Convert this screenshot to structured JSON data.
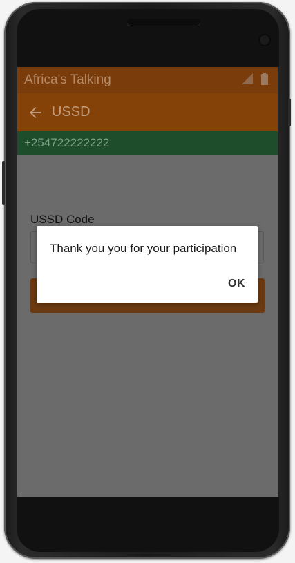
{
  "status_bar": {
    "title": "Africa's Talking",
    "icons": [
      "signal-icon",
      "battery-icon"
    ]
  },
  "app_bar": {
    "back_icon": "arrow-left-icon",
    "title": "USSD"
  },
  "phone_bar": {
    "number": "+254722222222"
  },
  "form": {
    "ussd_label": "USSD Code",
    "ussd_value": ""
  },
  "dialog": {
    "message": "Thank you you for your participation",
    "ok_label": "OK"
  },
  "colors": {
    "status_bar": "#7a3c0b",
    "app_bar": "#844108",
    "phone_bar": "#1d4d2a",
    "scrim": "#6b6b6b",
    "dialog_bg": "#ffffff"
  }
}
